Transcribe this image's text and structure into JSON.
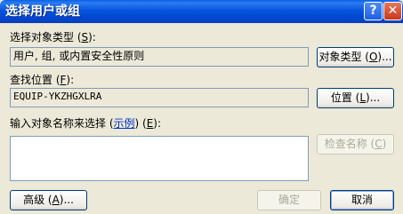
{
  "window": {
    "title": "选择用户或组",
    "help_label": "?",
    "close_label": "✕"
  },
  "object_type": {
    "label_pre": "选择对象类型 (",
    "label_key": "S",
    "label_post": "):",
    "value": "用户, 组, 或内置安全性原则",
    "button_pre": "对象类型 (",
    "button_key": "O",
    "button_post": ")..."
  },
  "location": {
    "label_pre": "查找位置 (",
    "label_key": "F",
    "label_post": "):",
    "value": "EQUIP-YKZHGXLRA",
    "button_pre": "位置 (",
    "button_key": "L",
    "button_post": ")..."
  },
  "names": {
    "label_pre": "输入对象名称来选择 (",
    "example_link": "示例",
    "label_mid": ") (",
    "label_key": "E",
    "label_post": "):",
    "value": "",
    "check_pre": "检查名称 (",
    "check_key": "C",
    "check_post": ")"
  },
  "footer": {
    "advanced_pre": "高级 (",
    "advanced_key": "A",
    "advanced_post": ")...",
    "ok_label": "确定",
    "cancel_label": "取消"
  }
}
